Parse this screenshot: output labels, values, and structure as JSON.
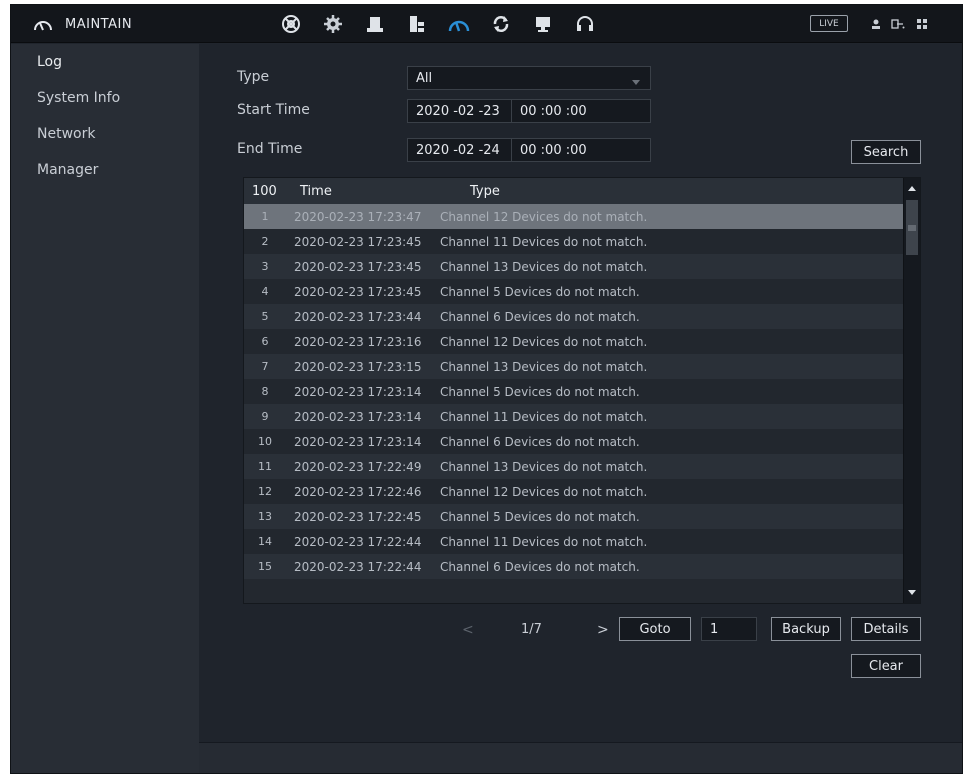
{
  "header": {
    "title": "MAINTAIN",
    "live_label": "LIVE",
    "toolbar_icons": [
      "network-icon",
      "settings-icon",
      "storage-icon",
      "system-icon",
      "maintain-icon",
      "update-icon",
      "display-icon",
      "support-icon"
    ],
    "status_icons": [
      "user-icon",
      "logout-icon",
      "grid-icon"
    ]
  },
  "sidebar": {
    "items": [
      {
        "label": "Log",
        "active": true
      },
      {
        "label": "System Info"
      },
      {
        "label": "Network"
      },
      {
        "label": "Manager"
      }
    ]
  },
  "filters": {
    "type_label": "Type",
    "type_value": "All",
    "start_label": "Start Time",
    "start_date": "2020 -02 -23",
    "start_time": "00 :00 :00",
    "end_label": "End Time",
    "end_date": "2020 -02 -24",
    "end_time": "00 :00 :00",
    "search_label": "Search"
  },
  "table": {
    "headers": {
      "count": "100",
      "time": "Time",
      "type": "Type"
    },
    "rows": [
      {
        "num": "1",
        "time": "2020-02-23 17:23:47",
        "type": "Channel 12 Devices do not match."
      },
      {
        "num": "2",
        "time": "2020-02-23 17:23:45",
        "type": "Channel 11 Devices do not match."
      },
      {
        "num": "3",
        "time": "2020-02-23 17:23:45",
        "type": "Channel 13 Devices do not match."
      },
      {
        "num": "4",
        "time": "2020-02-23 17:23:45",
        "type": "Channel 5 Devices do not match."
      },
      {
        "num": "5",
        "time": "2020-02-23 17:23:44",
        "type": "Channel 6 Devices do not match."
      },
      {
        "num": "6",
        "time": "2020-02-23 17:23:16",
        "type": "Channel 12 Devices do not match."
      },
      {
        "num": "7",
        "time": "2020-02-23 17:23:15",
        "type": "Channel 13 Devices do not match."
      },
      {
        "num": "8",
        "time": "2020-02-23 17:23:14",
        "type": "Channel 5 Devices do not match."
      },
      {
        "num": "9",
        "time": "2020-02-23 17:23:14",
        "type": "Channel 11 Devices do not match."
      },
      {
        "num": "10",
        "time": "2020-02-23 17:23:14",
        "type": "Channel 6 Devices do not match."
      },
      {
        "num": "11",
        "time": "2020-02-23 17:22:49",
        "type": "Channel 13 Devices do not match."
      },
      {
        "num": "12",
        "time": "2020-02-23 17:22:46",
        "type": "Channel 12 Devices do not match."
      },
      {
        "num": "13",
        "time": "2020-02-23 17:22:45",
        "type": "Channel 5 Devices do not match."
      },
      {
        "num": "14",
        "time": "2020-02-23 17:22:44",
        "type": "Channel 11 Devices do not match."
      },
      {
        "num": "15",
        "time": "2020-02-23 17:22:44",
        "type": "Channel 6 Devices do not match."
      }
    ]
  },
  "pagination": {
    "prev": "<",
    "page": "1/7",
    "next": ">",
    "goto_label": "Goto",
    "goto_value": "1",
    "backup_label": "Backup",
    "details_label": "Details",
    "clear_label": "Clear"
  },
  "colors": {
    "accent": "#2a8fd6",
    "background": "#1f242c",
    "sidebar": "#282d35",
    "selected_row": "#6e747c"
  }
}
